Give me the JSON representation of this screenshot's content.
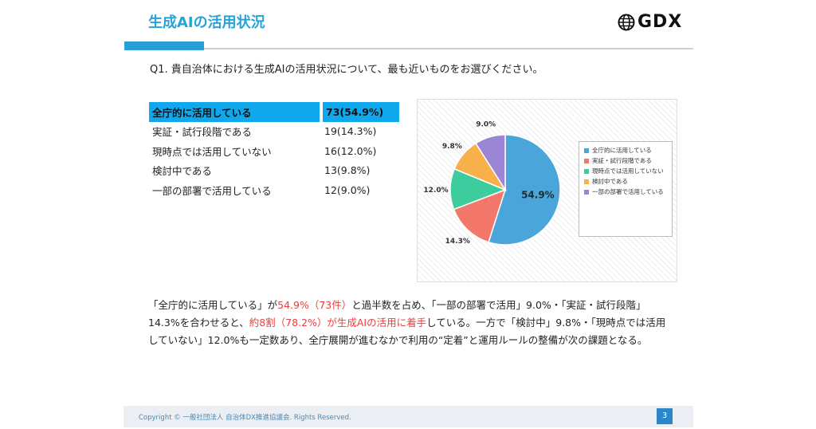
{
  "slide": {
    "title": "生成AIの活用状況",
    "logo_text": "GDX",
    "question": "Q1. 貴自治体における生成AIの活用状況について、最も近いものをお選びください。"
  },
  "results_table": [
    {
      "label": "全庁的に活用している",
      "value": "73(54.9%)"
    },
    {
      "label": "実証・試行段階である",
      "value": "19(14.3%)"
    },
    {
      "label": "現時点では活用していない",
      "value": "16(12.0%)"
    },
    {
      "label": "検討中である",
      "value": "13(9.8%)"
    },
    {
      "label": "一部の部署で活用している",
      "value": "12(9.0%)"
    }
  ],
  "chart_data": {
    "type": "pie",
    "categories": [
      "全庁的に活用している",
      "実証・試行段階である",
      "現時点では活用していない",
      "検討中である",
      "一部の部署で活用している"
    ],
    "values": [
      54.9,
      14.3,
      12.0,
      9.8,
      9.0
    ],
    "labels": [
      "54.9%",
      "14.3%",
      "12.0%",
      "9.8%",
      "9.0%"
    ],
    "colors": [
      "#4aa6da",
      "#f4776c",
      "#3ccc9e",
      "#f7b04a",
      "#9b86d6"
    ],
    "legend_position": "right"
  },
  "summary": {
    "s1": "「全庁的に活用している」が",
    "s2": "54.9%（73件）",
    "s3": "と過半数を占め、「一部の部署で活用」9.0%・「実証・試行段階」14.3%を合わせると、",
    "s4": "約8割（78.2%）が生成AIの活用に着手",
    "s5": "している。一方で「検討中」9.8%・「現時点では活用していない」12.0%も一定数あり、全庁展開が進むなかで利用の“定着”と運用ルールの整備が次の課題となる。"
  },
  "footer": {
    "copyright": "Copyright © 一般社団法人 自治体DX推進協議会. Rights Reserved.",
    "page": "3"
  }
}
